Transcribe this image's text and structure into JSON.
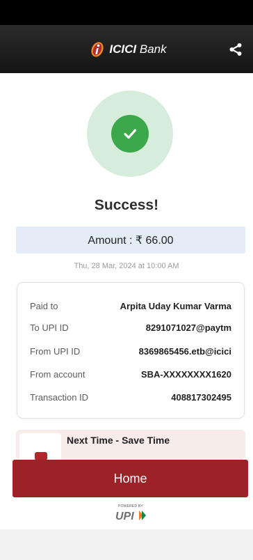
{
  "header": {
    "brand_primary": "ICICI",
    "brand_secondary": "Bank",
    "brand_color": "#b02a2e",
    "share_icon": "share-icon"
  },
  "status": {
    "title": "Success!",
    "icon": "check-icon",
    "color": "#3aa84b"
  },
  "amount": {
    "label": "Amount : ₹ 66.00"
  },
  "datetime": "Thu, 28 Mar, 2024 at 10:00 AM",
  "details": [
    {
      "key": "Paid to",
      "value": "Arpita Uday Kumar Varma"
    },
    {
      "key": "To UPI ID",
      "value": "8291071027@paytm"
    },
    {
      "key": "From UPI ID",
      "value": "8369865456.etb@icici"
    },
    {
      "key": "From account",
      "value": "SBA-XXXXXXXX1620"
    },
    {
      "key": "Transaction ID",
      "value": "408817302495"
    }
  ],
  "promo": {
    "text": "Next Time - Save Time"
  },
  "home_button": {
    "label": "Home",
    "color": "#9c2227"
  },
  "upi": {
    "powered_by": "POWERED BY",
    "logo_text": "UPI"
  }
}
